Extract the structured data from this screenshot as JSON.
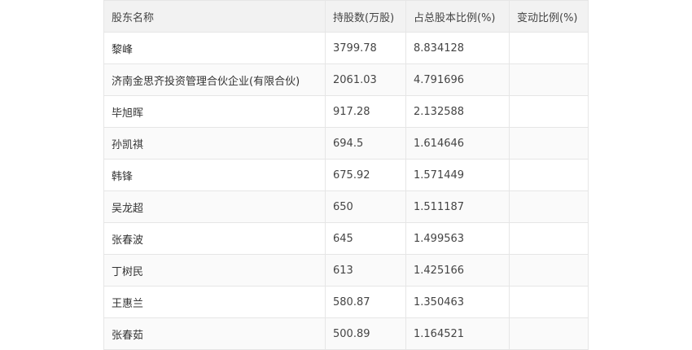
{
  "table": {
    "headers": [
      "股东名称",
      "持股数(万股)",
      "占总股本比例(%)",
      "变动比例(%)"
    ],
    "rows": [
      {
        "name": "黎峰",
        "shares": "3799.78",
        "ratio": "8.834128",
        "change": ""
      },
      {
        "name": "济南金思齐投资管理合伙企业(有限合伙)",
        "shares": "2061.03",
        "ratio": "4.791696",
        "change": ""
      },
      {
        "name": "毕旭晖",
        "shares": "917.28",
        "ratio": "2.132588",
        "change": ""
      },
      {
        "name": "孙凯祺",
        "shares": "694.5",
        "ratio": "1.614646",
        "change": ""
      },
      {
        "name": "韩锋",
        "shares": "675.92",
        "ratio": "1.571449",
        "change": ""
      },
      {
        "name": "吴龙超",
        "shares": "650",
        "ratio": "1.511187",
        "change": ""
      },
      {
        "name": "张春波",
        "shares": "645",
        "ratio": "1.499563",
        "change": ""
      },
      {
        "name": "丁树民",
        "shares": "613",
        "ratio": "1.425166",
        "change": ""
      },
      {
        "name": "王惠兰",
        "shares": "580.87",
        "ratio": "1.350463",
        "change": ""
      },
      {
        "name": "张春茹",
        "shares": "500.89",
        "ratio": "1.164521",
        "change": ""
      }
    ]
  }
}
